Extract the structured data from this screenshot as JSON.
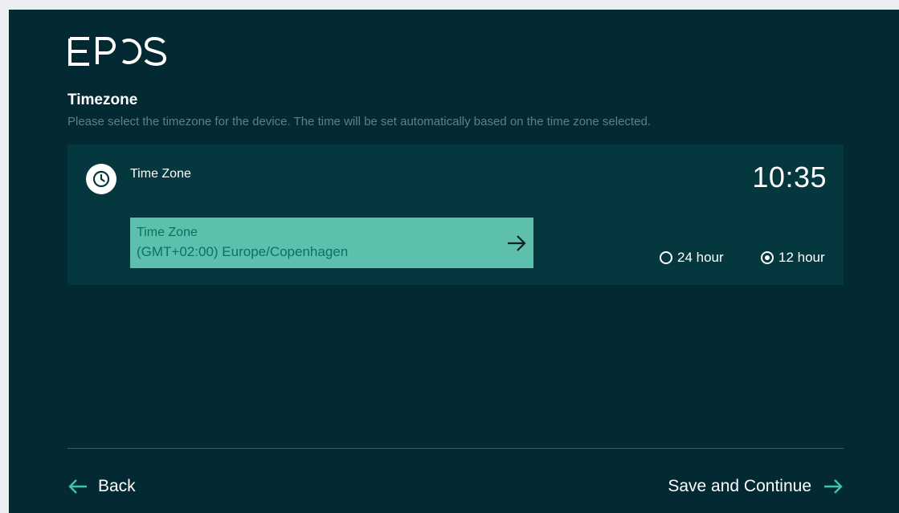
{
  "brand": {
    "logo_text": "EPOS"
  },
  "page": {
    "title": "Timezone",
    "subtitle": "Please select the timezone for the device. The time will be set automatically based on the time zone selected."
  },
  "card": {
    "icon": "clock-icon",
    "label": "Time Zone",
    "current_time": "10:35",
    "timezone_button": {
      "caption": "Time Zone",
      "value": "(GMT+02:00) Europe/Copenhagen",
      "icon": "arrow-right-icon"
    },
    "format_options": [
      {
        "label": "24 hour",
        "selected": false
      },
      {
        "label": "12 hour",
        "selected": true
      }
    ]
  },
  "footer": {
    "back_label": "Back",
    "back_icon": "arrow-left-icon",
    "save_label": "Save and Continue",
    "save_icon": "arrow-right-icon"
  },
  "colors": {
    "background": "#032a33",
    "card": "#05373f",
    "accent": "#5cc0ad",
    "accent_text": "#0e6f63",
    "nav_arrow": "#3fc3ad"
  }
}
